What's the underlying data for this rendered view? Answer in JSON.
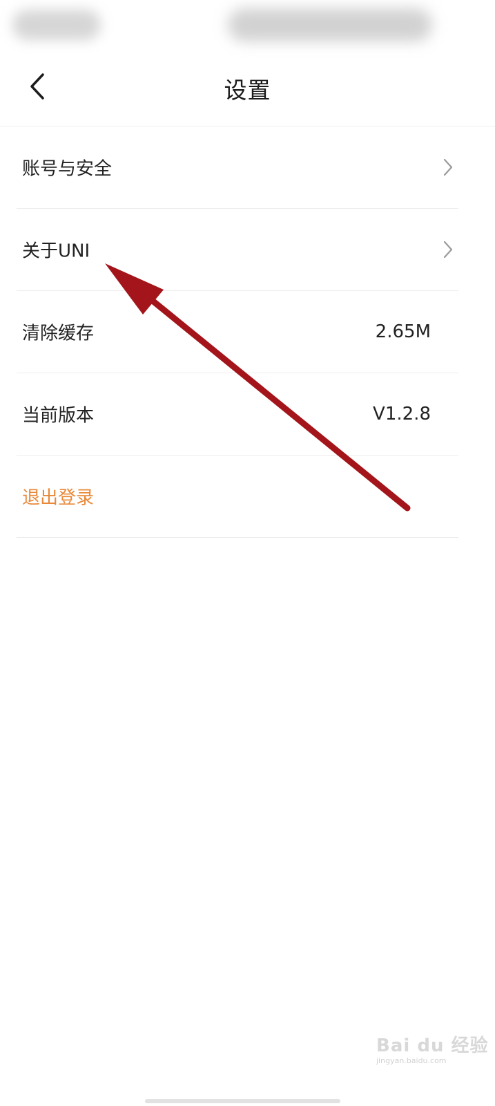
{
  "header": {
    "title": "设置",
    "back_icon": "chevron-left-icon"
  },
  "settings": {
    "items": [
      {
        "label": "账号与安全",
        "value": "",
        "chevron": true
      },
      {
        "label": "关于UNI",
        "value": "",
        "chevron": true
      },
      {
        "label": "清除缓存",
        "value": "2.65M",
        "chevron": false
      },
      {
        "label": "当前版本",
        "value": "V1.2.8",
        "chevron": false
      }
    ],
    "logout_label": "退出登录"
  },
  "colors": {
    "logout": "#e8893a",
    "annotation_arrow": "#a3151b",
    "text": "#222222",
    "divider": "#ececec"
  },
  "watermark": {
    "text": "Bai du 经验",
    "sub": "jingyan.baidu.com"
  }
}
